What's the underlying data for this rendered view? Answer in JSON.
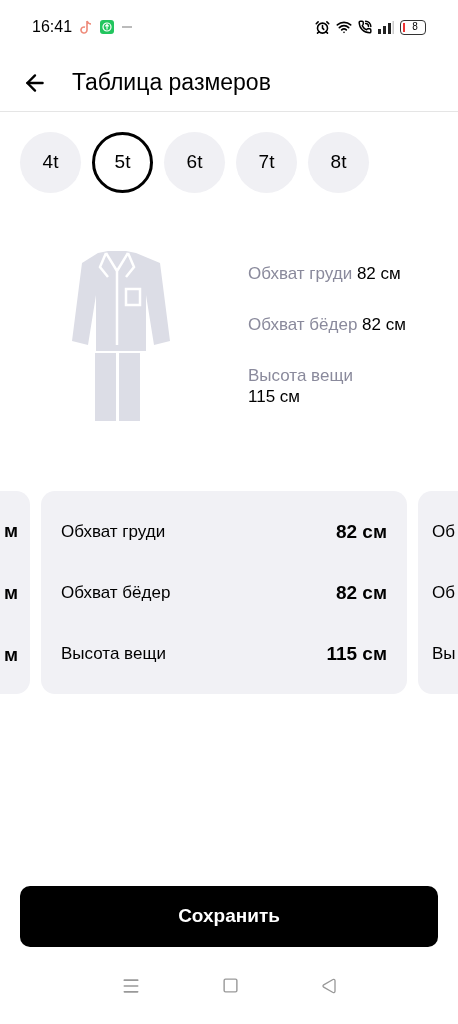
{
  "status_bar": {
    "time": "16:41",
    "battery": "8"
  },
  "header": {
    "title": "Таблица размеров"
  },
  "sizes": [
    {
      "label": "4t",
      "selected": false
    },
    {
      "label": "5t",
      "selected": true
    },
    {
      "label": "6t",
      "selected": false
    },
    {
      "label": "7t",
      "selected": false
    },
    {
      "label": "8t",
      "selected": false
    }
  ],
  "summary": [
    {
      "label": "Обхват груди",
      "value": "82 см",
      "kind": "inline"
    },
    {
      "label": "Обхват бёдер",
      "value": "82 см",
      "kind": "inline"
    },
    {
      "label": "Высота вещи",
      "value": "115 см",
      "kind": "stacked"
    }
  ],
  "cards": {
    "previous": [
      "м",
      "м",
      "м"
    ],
    "current": [
      {
        "label": "Обхват груди",
        "value": "82 см"
      },
      {
        "label": "Обхват бёдер",
        "value": "82 см"
      },
      {
        "label": "Высота вещи",
        "value": "115 см"
      }
    ],
    "next": [
      "Об",
      "Об",
      "Вы"
    ]
  },
  "save_button": "Сохранить"
}
